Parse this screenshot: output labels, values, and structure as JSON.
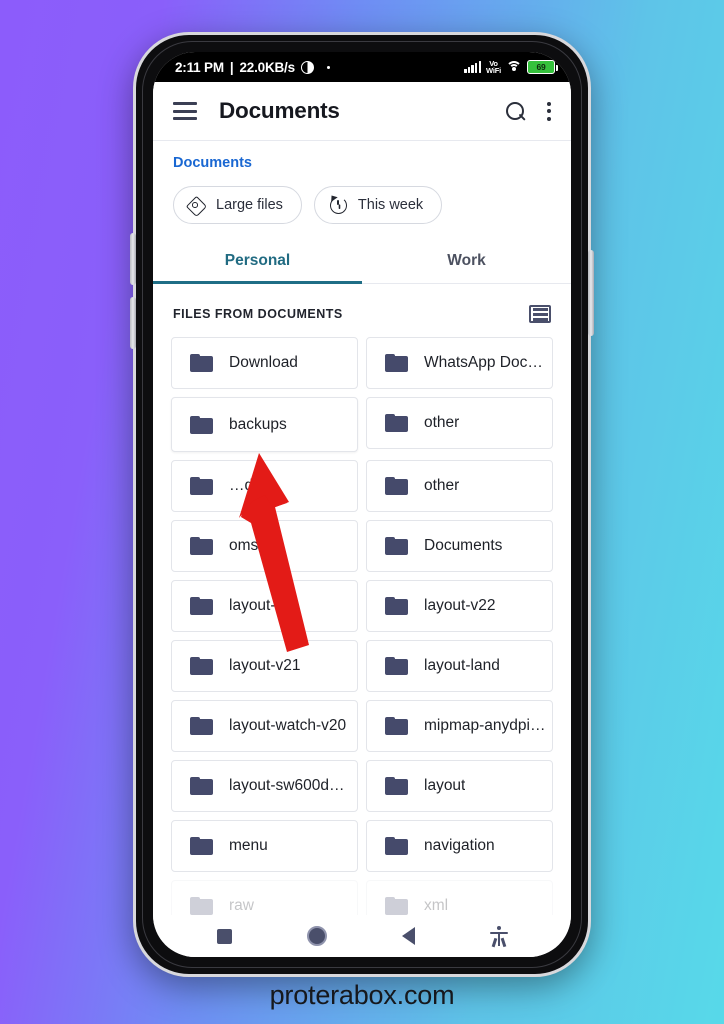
{
  "status_bar": {
    "time": "2:11 PM",
    "separator": "|",
    "network_speed": "22.0KB/s",
    "sync_icon": "sync-circle-icon",
    "dot": "·",
    "signal_icon": "cellular-signal-icon",
    "volte_line1": "Vo",
    "volte_line2": "WiFi",
    "wifi_icon": "wifi-icon",
    "battery_level": "69",
    "battery_icon": "battery-icon"
  },
  "app_bar": {
    "menu_icon": "hamburger-menu-icon",
    "title": "Documents",
    "search_icon": "search-icon",
    "overflow_icon": "kebab-menu-icon"
  },
  "breadcrumb": {
    "label": "Documents"
  },
  "chips": [
    {
      "label": "Large files",
      "icon": "tag-icon"
    },
    {
      "label": "This week",
      "icon": "history-icon"
    }
  ],
  "tabs": [
    {
      "label": "Personal",
      "active": true
    },
    {
      "label": "Work",
      "active": false
    }
  ],
  "section": {
    "title": "FILES FROM DOCUMENTS",
    "view_toggle_icon": "list-view-icon"
  },
  "folders": [
    {
      "label": "Download",
      "icon": "folder-icon",
      "state": "normal"
    },
    {
      "label": "WhatsApp Doc…",
      "icon": "folder-icon",
      "state": "normal"
    },
    {
      "label": "backups",
      "icon": "folder-icon",
      "state": "highlighted"
    },
    {
      "label": "other",
      "icon": "folder-icon",
      "state": "normal"
    },
    {
      "label": "…dk",
      "icon": "folder-icon",
      "state": "normal"
    },
    {
      "label": "other",
      "icon": "folder-icon",
      "state": "normal"
    },
    {
      "label": "oms…",
      "icon": "folder-icon",
      "state": "normal"
    },
    {
      "label": "Documents",
      "icon": "folder-icon",
      "state": "normal"
    },
    {
      "label": "layout-",
      "icon": "folder-icon",
      "state": "normal"
    },
    {
      "label": "layout-v22",
      "icon": "folder-icon",
      "state": "normal"
    },
    {
      "label": "layout-v21",
      "icon": "folder-icon",
      "state": "normal"
    },
    {
      "label": "layout-land",
      "icon": "folder-icon",
      "state": "normal"
    },
    {
      "label": "layout-watch-v20",
      "icon": "folder-icon",
      "state": "normal"
    },
    {
      "label": "mipmap-anydpi…",
      "icon": "folder-icon",
      "state": "normal"
    },
    {
      "label": "layout-sw600d…",
      "icon": "folder-icon",
      "state": "normal"
    },
    {
      "label": "layout",
      "icon": "folder-icon",
      "state": "normal"
    },
    {
      "label": "menu",
      "icon": "folder-icon",
      "state": "normal"
    },
    {
      "label": "navigation",
      "icon": "folder-icon",
      "state": "normal"
    },
    {
      "label": "raw",
      "icon": "folder-icon",
      "state": "faded"
    },
    {
      "label": "xml",
      "icon": "folder-icon",
      "state": "faded"
    }
  ],
  "nav_bar": {
    "recent_icon": "recent-apps-icon",
    "home_icon": "home-icon",
    "back_icon": "back-icon",
    "accessibility_icon": "accessibility-icon"
  },
  "annotation": {
    "arrow_color": "#e31b17",
    "arrow_icon": "red-up-arrow-annotation",
    "points_at": "backups"
  },
  "watermark": {
    "text": "proterabox.com"
  },
  "colors": {
    "background_left": "#8c5cfb",
    "background_right": "#57d9e9",
    "breadcrumb_blue": "#1967d2",
    "tab_active_teal": "#216b82",
    "folder_icon": "#454a6b",
    "battery_green": "#35c13c"
  }
}
